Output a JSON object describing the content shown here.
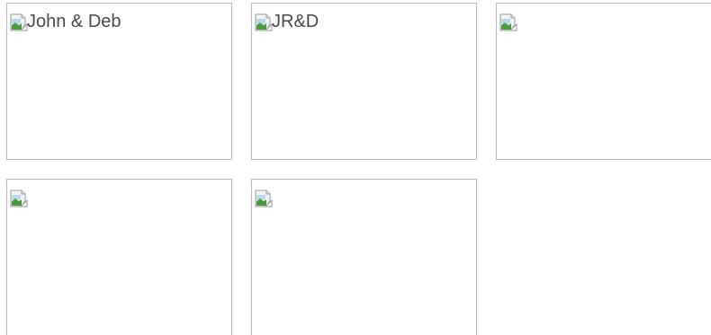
{
  "gallery": {
    "tiles": [
      {
        "alt": "John & Deb",
        "icon": "broken-image-icon"
      },
      {
        "alt": "JR&D",
        "icon": "broken-image-icon"
      },
      {
        "alt": "",
        "icon": "broken-image-icon"
      },
      {
        "alt": "",
        "icon": "broken-image-icon"
      },
      {
        "alt": "",
        "icon": "broken-image-icon"
      }
    ]
  },
  "colors": {
    "tile_border": "#b9b9b9",
    "alt_text": "#4a4a4a",
    "background": "#ffffff"
  }
}
